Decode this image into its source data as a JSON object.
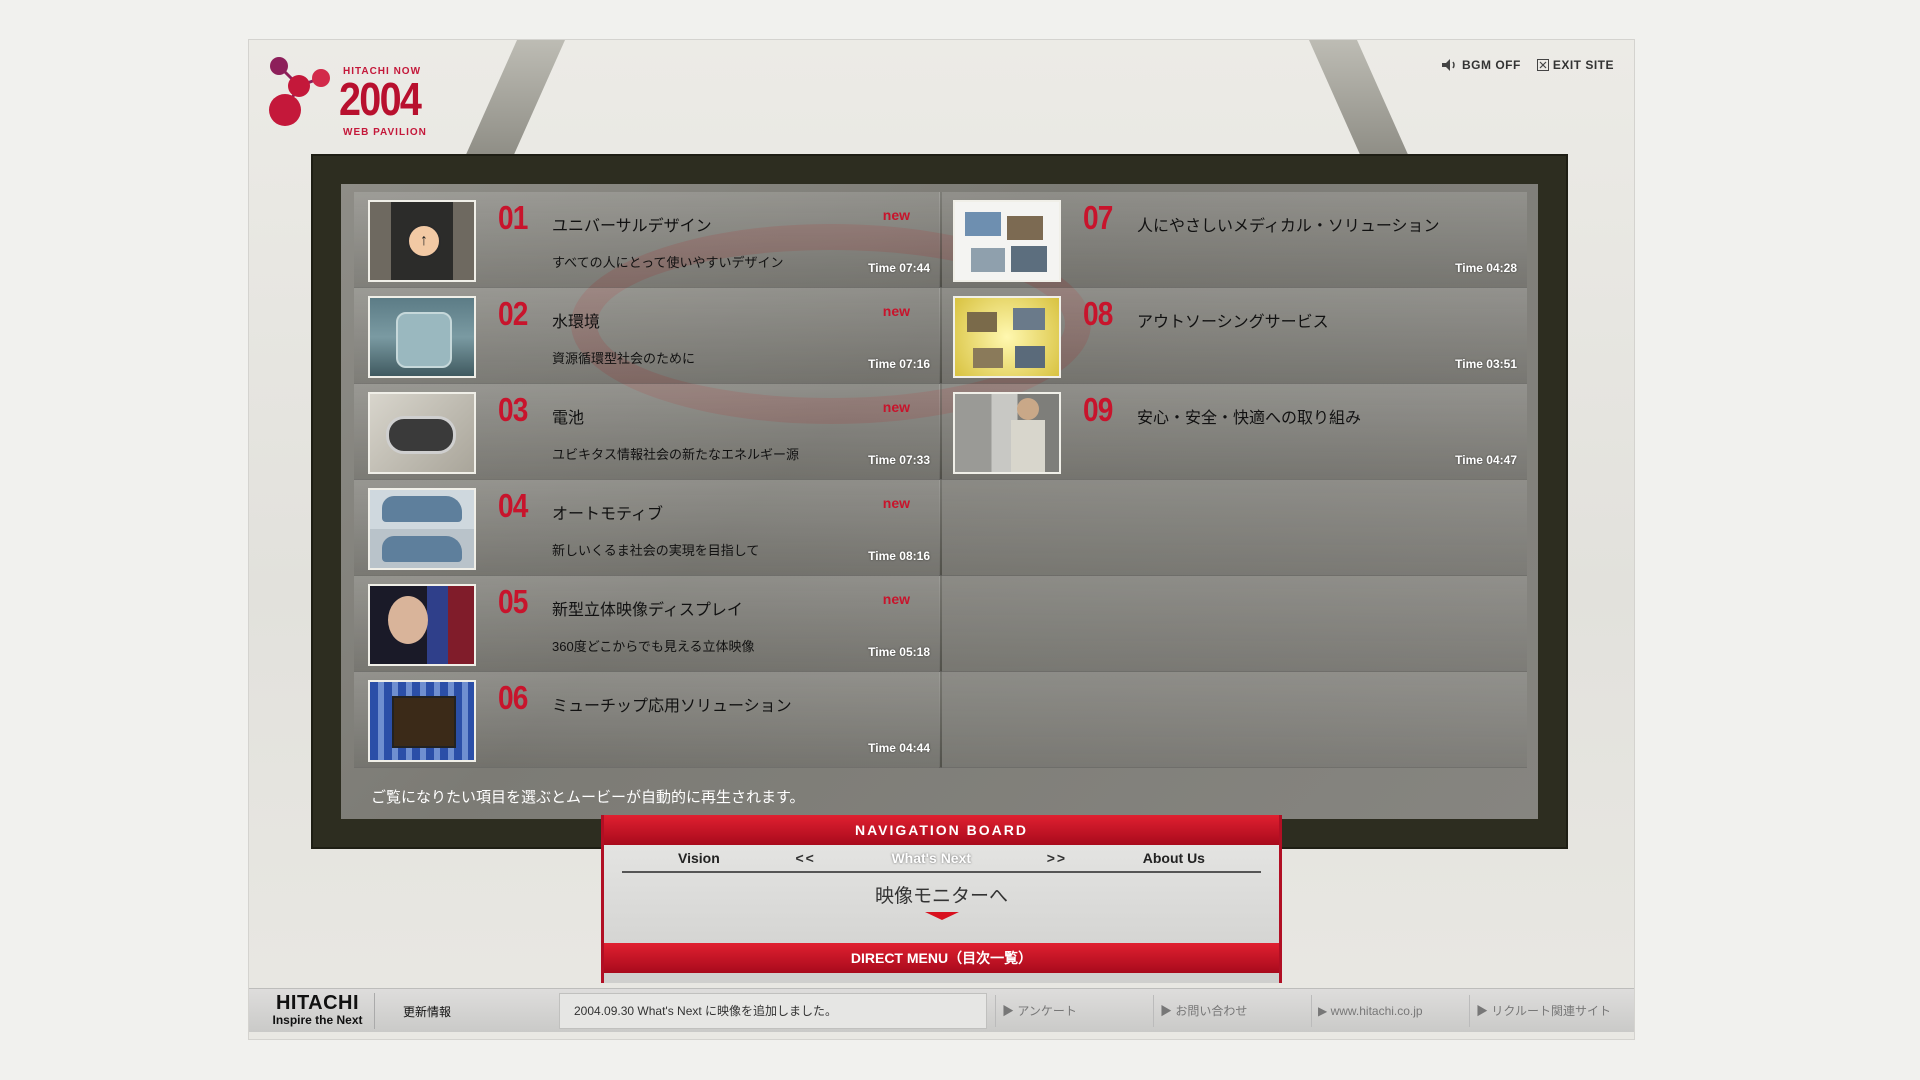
{
  "logo": {
    "small": "HITACHI NOW",
    "year": "2004",
    "sub": "WEB PAVILION"
  },
  "toplinks": {
    "bgm": "BGM OFF",
    "exit": "EXIT SITE"
  },
  "items_left": [
    {
      "num": "01",
      "title": "ユニバーサルデザイン",
      "sub": "すべての人にとって使いやすいデザイン",
      "badge": "new",
      "time": "Time 07:44"
    },
    {
      "num": "02",
      "title": "水環境",
      "sub": "資源循環型社会のために",
      "badge": "new",
      "time": "Time 07:16"
    },
    {
      "num": "03",
      "title": "電池",
      "sub": "ユビキタス情報社会の新たなエネルギー源",
      "badge": "new",
      "time": "Time 07:33"
    },
    {
      "num": "04",
      "title": "オートモティブ",
      "sub": "新しいくるま社会の実現を目指して",
      "badge": "new",
      "time": "Time 08:16"
    },
    {
      "num": "05",
      "title": "新型立体映像ディスプレイ",
      "sub": "360度どこからでも見える立体映像",
      "badge": "new",
      "time": "Time 05:18"
    },
    {
      "num": "06",
      "title": "ミューチップ応用ソリューション",
      "sub": "",
      "badge": "",
      "time": "Time 04:44"
    }
  ],
  "items_right": [
    {
      "num": "07",
      "title": "人にやさしいメディカル・ソリューション",
      "time": "Time 04:28"
    },
    {
      "num": "08",
      "title": "アウトソーシングサービス",
      "time": "Time 03:51"
    },
    {
      "num": "09",
      "title": "安心・安全・快適への取り組み",
      "time": "Time 04:47"
    }
  ],
  "hint": "ご覧になりたい項目を選ぶとムービーが自動的に再生されます。",
  "navboard": {
    "title": "NAVIGATION BOARD",
    "tab_vision": "Vision",
    "prev": "<<",
    "tab_current": "What's Next",
    "next": ">>",
    "tab_about": "About Us",
    "monitor_link": "映像モニターへ",
    "direct_menu": "DIRECT MENU（目次一覧）"
  },
  "footer": {
    "brand": "HITACHI",
    "tagline": "Inspire the Next",
    "news_label": "更新情報",
    "news_text": "2004.09.30 What's Next に映像を追加しました。",
    "links": [
      "▶ アンケート",
      "▶ お問い合わせ",
      "▶ www.hitachi.co.jp",
      "▶ リクルート関連サイト"
    ]
  },
  "colors": {
    "accent": "#c8142c",
    "monitor_frame": "#2d2d20"
  },
  "icons": [
    "speaker-icon",
    "exit-icon"
  ]
}
